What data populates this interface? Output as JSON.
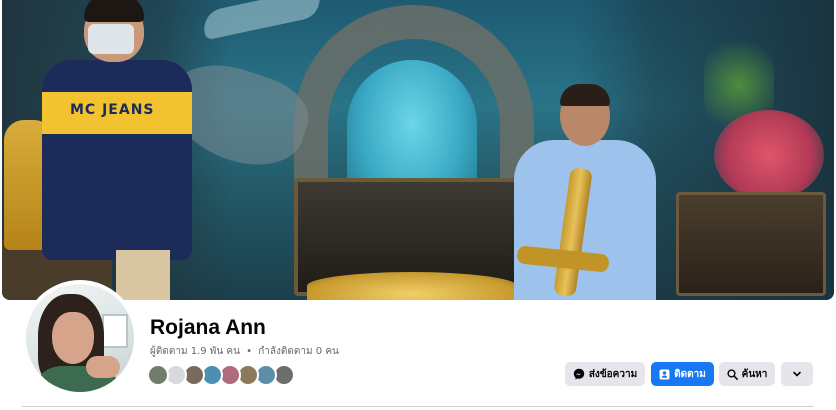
{
  "profile": {
    "name": "Rojana Ann",
    "followers_text": "ผู้ติดตาม 1.9 พัน คน",
    "separator": "•",
    "following_text": "กำลังติดตาม 0 คน"
  },
  "cover": {
    "shirt_text": "MC JEANS"
  },
  "follower_avatars": [
    {
      "color": "#6f7d6a"
    },
    {
      "color": "#d7dadd"
    },
    {
      "color": "#7a6a5c"
    },
    {
      "color": "#4c8fb0"
    },
    {
      "color": "#b06a7e"
    },
    {
      "color": "#8a7a5a"
    },
    {
      "color": "#5b8fa8"
    },
    {
      "color": "#6d6d6d"
    }
  ],
  "actions": {
    "message_label": "ส่งข้อความ",
    "follow_label": "ติดตาม",
    "search_label": "ค้นหา"
  },
  "icons": {
    "message": "messenger-icon",
    "follow": "follow-icon",
    "search": "search-icon",
    "more": "chevron-down-icon"
  },
  "colors": {
    "primary": "#1877f2",
    "secondary_button": "#e4e6eb",
    "text_primary": "#050505",
    "text_secondary": "#65676b"
  }
}
